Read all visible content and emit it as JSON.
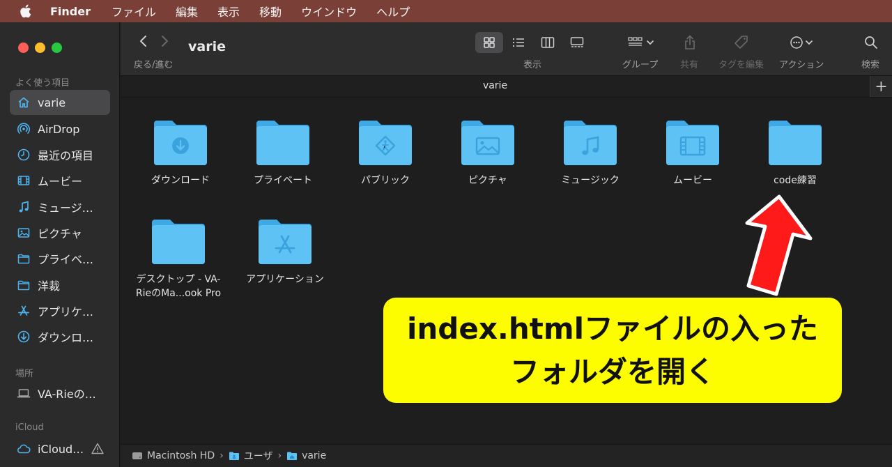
{
  "menubar": {
    "app_name": "Finder",
    "items": [
      "ファイル",
      "編集",
      "表示",
      "移動",
      "ウインドウ",
      "ヘルプ"
    ]
  },
  "sidebar": {
    "favorites_header": "よく使う項目",
    "favorites": [
      {
        "label": "varie",
        "icon": "home-icon",
        "active": true
      },
      {
        "label": "AirDrop",
        "icon": "airdrop-icon"
      },
      {
        "label": "最近の項目",
        "icon": "clock-icon"
      },
      {
        "label": "ムービー",
        "icon": "film-icon"
      },
      {
        "label": "ミュージ…",
        "icon": "music-note-icon"
      },
      {
        "label": "ピクチャ",
        "icon": "photo-icon"
      },
      {
        "label": "プライベ…",
        "icon": "folder-icon"
      },
      {
        "label": "洋裁",
        "icon": "folder-icon"
      },
      {
        "label": "アプリケ…",
        "icon": "app-store-icon"
      },
      {
        "label": "ダウンロ…",
        "icon": "download-icon"
      }
    ],
    "locations_header": "場所",
    "locations": [
      {
        "label": "VA-Rieの…",
        "icon": "laptop-icon"
      }
    ],
    "icloud_header": "iCloud",
    "icloud": [
      {
        "label": "iCloud…",
        "icon": "cloud-icon"
      }
    ]
  },
  "toolbar": {
    "back_forward_label": "戻る/進む",
    "window_title": "varie",
    "view_label": "表示",
    "group_label": "グループ",
    "share_label": "共有",
    "tags_label": "タグを編集",
    "action_label": "アクション",
    "search_label": "検索"
  },
  "tabbar": {
    "title": "varie",
    "add_label": "+"
  },
  "folders": [
    {
      "name": "ダウンロード",
      "glyph": "download"
    },
    {
      "name": "プライベート",
      "glyph": "none"
    },
    {
      "name": "パブリック",
      "glyph": "public"
    },
    {
      "name": "ピクチャ",
      "glyph": "photo"
    },
    {
      "name": "ミュージック",
      "glyph": "music"
    },
    {
      "name": "ムービー",
      "glyph": "film"
    },
    {
      "name": "code練習",
      "glyph": "none"
    },
    {
      "name": "デスクトップ - VA-RieのMa...ook Pro",
      "glyph": "none"
    },
    {
      "name": "アプリケーション",
      "glyph": "apps"
    }
  ],
  "pathbar": {
    "segments": [
      "Macintosh HD",
      "ユーザ",
      "varie"
    ]
  },
  "annotation": {
    "line1": "index.htmlファイルの入った",
    "line2": "フォルダを開く",
    "box_color": "#fdfd00",
    "arrow_color": "#ff1a1a"
  },
  "colors": {
    "folder_blue": "#5ec2f5",
    "menubar_bg": "#7a3f37"
  }
}
